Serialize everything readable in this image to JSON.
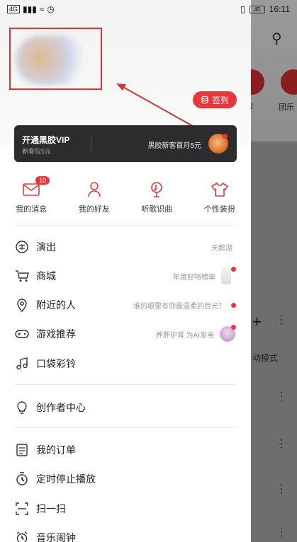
{
  "status_bar": {
    "left": "4G",
    "time": "16:11",
    "battery": "45"
  },
  "background_app": {
    "label_1": "荐",
    "label_2": "团乐",
    "mode_text": "动模式"
  },
  "header": {
    "checkin_label": "签到"
  },
  "vip_card": {
    "title": "开通黑胶VIP",
    "subtitle": "新客仅5元",
    "promo": "黑胶新客首月5元"
  },
  "quick_actions": [
    {
      "label": "我的消息",
      "badge": "10",
      "icon": "envelope-icon"
    },
    {
      "label": "我的好友",
      "icon": "person-icon"
    },
    {
      "label": "听歌识曲",
      "icon": "music-recognize-icon"
    },
    {
      "label": "个性装扮",
      "icon": "tshirt-icon"
    }
  ],
  "menu": {
    "show": {
      "label": "演出",
      "right": "天鹅湖"
    },
    "store": {
      "label": "商城",
      "right": "年度好物榜单"
    },
    "nearby": {
      "label": "附近的人",
      "right": "谁的眼里有你最温柔的目光？"
    },
    "games": {
      "label": "游戏推荐",
      "right": "养肝护肾 为AI发电"
    },
    "ringtone": {
      "label": "口袋彩铃"
    },
    "creator": {
      "label": "创作者中心"
    },
    "orders": {
      "label": "我的订单"
    },
    "timer": {
      "label": "定时停止播放"
    },
    "scan": {
      "label": "扫一扫"
    },
    "alarm": {
      "label": "音乐闹钟"
    }
  },
  "colors": {
    "accent": "#e8373b",
    "vip_bg": "#2c2c2e",
    "annotation": "#d33333"
  }
}
